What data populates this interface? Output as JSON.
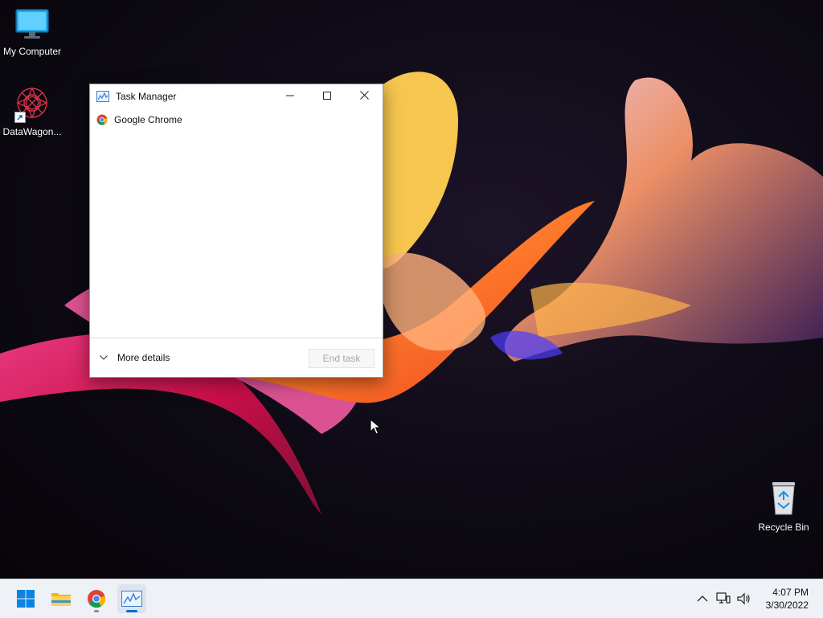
{
  "desktop": {
    "icons": [
      {
        "label": "My Computer",
        "icon": "monitor-icon"
      },
      {
        "label": "DataWagon...",
        "icon": "datawagon-shortcut-icon"
      },
      {
        "label": "Recycle Bin",
        "icon": "recycle-bin-icon"
      }
    ]
  },
  "task_manager": {
    "title": "Task Manager",
    "processes": [
      {
        "name": "Google Chrome",
        "icon": "chrome-icon"
      }
    ],
    "more_details_label": "More details",
    "end_task_label": "End task",
    "end_task_enabled": false
  },
  "taskbar": {
    "items": [
      {
        "name": "start",
        "icon": "windows-logo-icon"
      },
      {
        "name": "file-explorer",
        "icon": "folder-icon"
      },
      {
        "name": "google-chrome",
        "icon": "chrome-icon"
      },
      {
        "name": "task-manager",
        "icon": "task-manager-icon",
        "active": true
      }
    ],
    "tray": {
      "time": "4:07 PM",
      "date": "3/30/2022"
    }
  },
  "colors": {
    "accent": "#0078d4",
    "taskbar_bg": "#eef1f6",
    "wallpaper_dark": "#0b0812"
  }
}
